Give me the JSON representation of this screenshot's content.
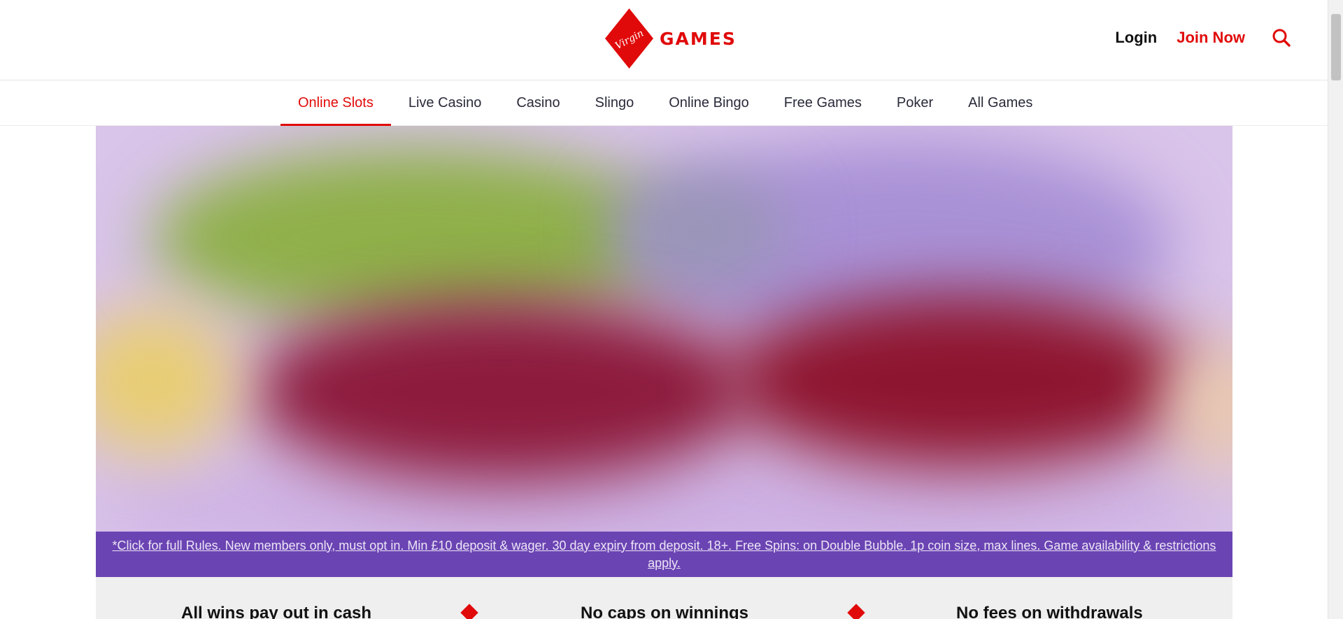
{
  "header": {
    "logo_script": "Virgin",
    "logo_word": "GAMES",
    "login_label": "Login",
    "join_label": "Join Now",
    "search_icon": "search-icon"
  },
  "nav": {
    "items": [
      {
        "label": "Online Slots",
        "active": true
      },
      {
        "label": "Live Casino",
        "active": false
      },
      {
        "label": "Casino",
        "active": false
      },
      {
        "label": "Slingo",
        "active": false
      },
      {
        "label": "Online Bingo",
        "active": false
      },
      {
        "label": "Free Games",
        "active": false
      },
      {
        "label": "Poker",
        "active": false
      },
      {
        "label": "All Games",
        "active": false
      }
    ]
  },
  "hero": {
    "terms": "*Click for full Rules. New members only, must opt in. Min £10 deposit & wager. 30 day expiry from deposit. 18+. Free Spins: on Double Bubble. 1p coin size, max lines. Game availability & restrictions apply."
  },
  "usp": {
    "items": [
      "All wins pay out in cash",
      "No caps on winnings",
      "No fees on withdrawals"
    ]
  },
  "colors": {
    "brand_red": "#e10a0a",
    "terms_purple": "#6b44b3",
    "usp_bg": "#efefef"
  }
}
